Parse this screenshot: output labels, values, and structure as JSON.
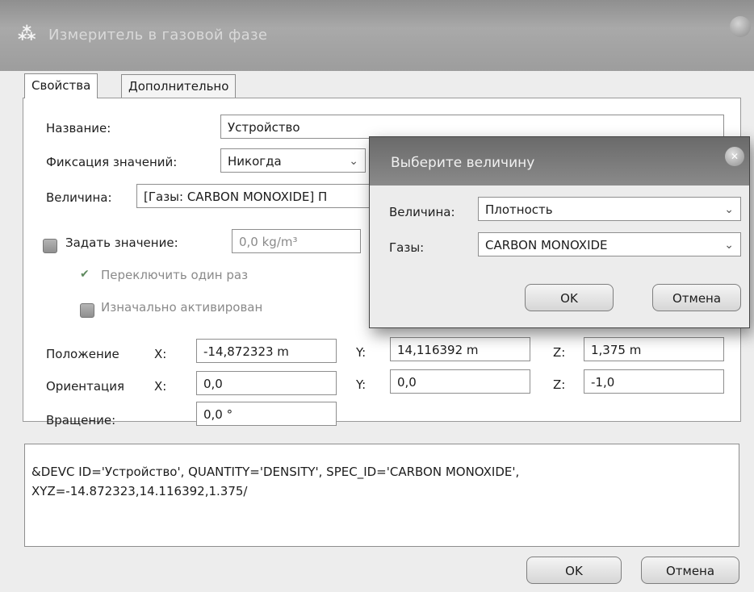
{
  "window": {
    "icon": "sensor-icon",
    "title": "Измеритель в газовой фазе"
  },
  "tabs": [
    {
      "label": "Свойства",
      "active": true
    },
    {
      "label": "Дополнительно",
      "active": false
    }
  ],
  "form": {
    "name_label": "Название:",
    "name_value": "Устройство",
    "freeze_label": "Фиксация значений:",
    "freeze_value": "Никогда",
    "quantity_label": "Величина:",
    "quantity_value": "[Газы: CARBON MONOXIDE] П",
    "set_value_label": "Задать значение:",
    "set_value_value": "0,0 kg/m³",
    "toggle_once_label": "Переключить один раз",
    "initially_active_label": "Изначально активирован",
    "position_label": "Положение",
    "orientation_label": "Ориентация",
    "rotation_label": "Вращение:",
    "x_label": "X:",
    "y_label": "Y:",
    "z_label": "Z:",
    "position": {
      "x": "-14,872323 m",
      "y": "14,116392 m",
      "z": "1,375 m"
    },
    "orientation": {
      "x": "0,0",
      "y": "0,0",
      "z": "-1,0"
    },
    "rotation_value": "0,0 °"
  },
  "code_text": "&DEVC ID='Устройство', QUANTITY='DENSITY', SPEC_ID='CARBON MONOXIDE', XYZ=-14.872323,14.116392,1.375/",
  "footer": {
    "ok_label": "OK",
    "cancel_label": "Отмена"
  },
  "popup": {
    "title": "Выберите величину",
    "quantity_label": "Величина:",
    "quantity_value": "Плотность",
    "gases_label": "Газы:",
    "gases_value": "CARBON MONOXIDE",
    "ok_label": "OK",
    "cancel_label": "Отмена"
  }
}
